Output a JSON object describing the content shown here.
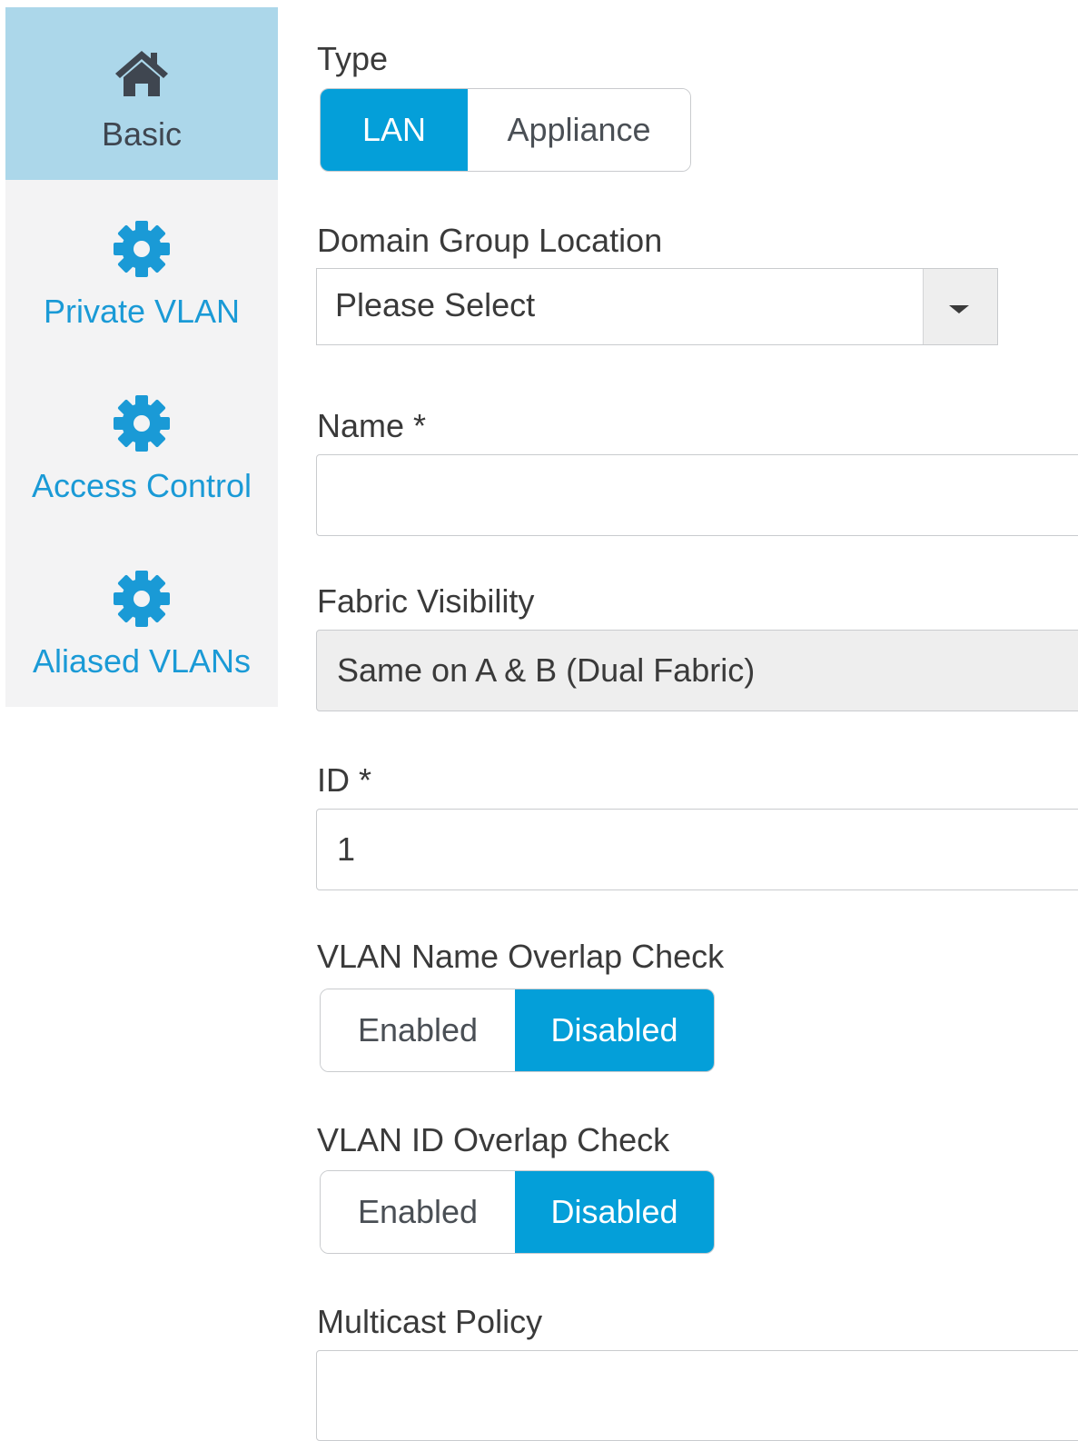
{
  "sidebar": {
    "items": [
      {
        "label": "Basic",
        "icon": "home-icon",
        "active": true
      },
      {
        "label": "Private VLAN",
        "icon": "gear-icon",
        "active": false
      },
      {
        "label": "Access Control",
        "icon": "gear-icon",
        "active": false
      },
      {
        "label": "Aliased VLANs",
        "icon": "gear-icon",
        "active": false
      }
    ]
  },
  "form": {
    "type": {
      "label": "Type",
      "options": [
        "LAN",
        "Appliance"
      ],
      "selected": "LAN"
    },
    "domain_group_location": {
      "label": "Domain Group Location",
      "value": "Please Select"
    },
    "name": {
      "label": "Name *",
      "value": ""
    },
    "fabric_visibility": {
      "label": "Fabric Visibility",
      "value": "Same on A & B (Dual Fabric)"
    },
    "id": {
      "label": "ID *",
      "value": "1"
    },
    "vlan_name_overlap_check": {
      "label": "VLAN Name Overlap Check",
      "options": [
        "Enabled",
        "Disabled"
      ],
      "selected": "Disabled"
    },
    "vlan_id_overlap_check": {
      "label": "VLAN ID Overlap Check",
      "options": [
        "Enabled",
        "Disabled"
      ],
      "selected": "Disabled"
    },
    "multicast_policy": {
      "label": "Multicast Policy",
      "value": ""
    }
  },
  "colors": {
    "accent": "#049fd9",
    "sidebar_active": "#acd7ea",
    "sidebar_bg": "#f3f3f4",
    "link": "#1a9ad6"
  }
}
